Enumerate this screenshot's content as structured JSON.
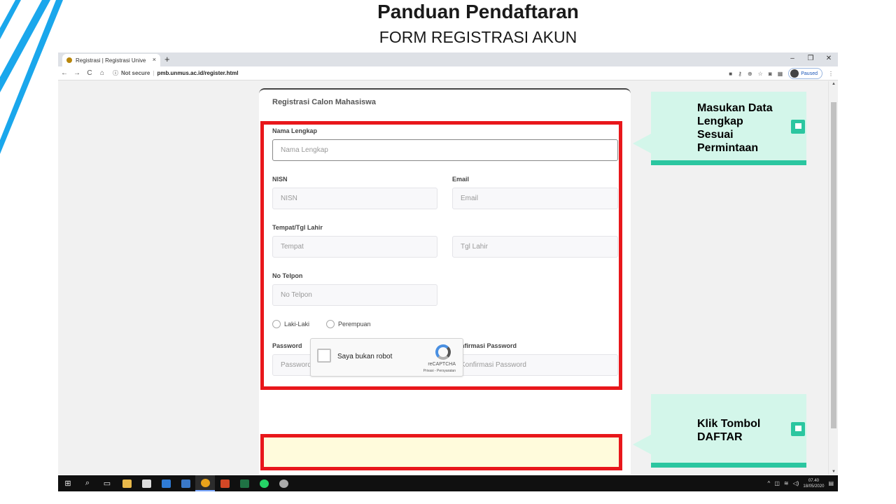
{
  "slide": {
    "title": "Panduan Pendaftaran",
    "subtitle": "FORM REGISTRASI AKUN"
  },
  "browser": {
    "tab_title": "Registrasi | Registrasi Unive",
    "tab_close": "×",
    "new_tab": "+",
    "win_minimize": "–",
    "win_restore": "❐",
    "win_close": "✕",
    "back": "←",
    "forward": "→",
    "reload": "C",
    "home": "⌂",
    "security": "Not secure",
    "url": "pmb.unmus.ac.id/register.html",
    "profile_status": "Paused",
    "menu": "⋮"
  },
  "form": {
    "title": "Registrasi Calon Mahasiswa",
    "nama_label": "Nama Lengkap",
    "nama_placeholder": "Nama Lengkap",
    "nisn_label": "NISN",
    "nisn_placeholder": "NISN",
    "email_label": "Email",
    "email_placeholder": "Email",
    "ttl_label": "Tempat/Tgl Lahir",
    "tempat_placeholder": "Tempat",
    "tgl_placeholder": "Tgl Lahir",
    "telpon_label": "No Telpon",
    "telpon_placeholder": "No Telpon",
    "gender_male": "Laki-Laki",
    "gender_female": "Perempuan",
    "password_label": "Password",
    "password_placeholder": "Password",
    "konfirmasi_label": "Konfirmasi Password",
    "konfirmasi_placeholder": "Konfirmasi Password"
  },
  "captcha": {
    "label": "Saya bukan robot",
    "brand": "reCAPTCHA",
    "terms": "Privasi - Persyaratan"
  },
  "callouts": {
    "data_text": "Masukan Data Lengkap Sesuai Permintaan",
    "daftar_text": "Klik Tombol DAFTAR"
  },
  "taskbar": {
    "time": "07.40",
    "date": "18/05/2020"
  },
  "colors": {
    "highlight_red": "#e8171b",
    "callout_bg": "#d3f6ea",
    "callout_accent": "#2bc6a0",
    "stripe_blue": "#1aa7ec"
  }
}
